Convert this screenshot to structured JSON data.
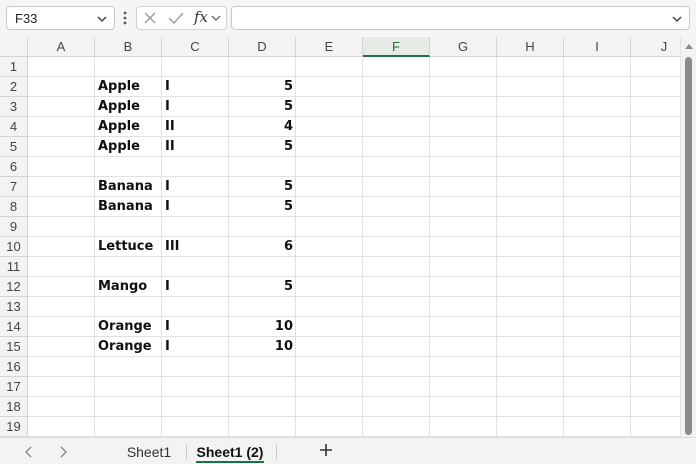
{
  "formula_bar": {
    "name_box": "F33",
    "formula": "",
    "fx_label": "fx",
    "icons": [
      "chevron-down-icon",
      "more-vertical-icon",
      "cancel-x-icon",
      "confirm-check-icon",
      "function-icon"
    ]
  },
  "grid": {
    "columns": [
      "A",
      "B",
      "C",
      "D",
      "E",
      "F",
      "G",
      "H",
      "I",
      "J"
    ],
    "selected_column": "F",
    "rows": [
      "1",
      "2",
      "3",
      "4",
      "5",
      "6",
      "7",
      "8",
      "9",
      "10",
      "11",
      "12",
      "13",
      "14",
      "15",
      "16",
      "17",
      "18",
      "19"
    ],
    "data": [
      {
        "row": "2",
        "B": "Apple",
        "C": "I",
        "D": "5"
      },
      {
        "row": "3",
        "B": "Apple",
        "C": "I",
        "D": "5"
      },
      {
        "row": "4",
        "B": "Apple",
        "C": "II",
        "D": "4"
      },
      {
        "row": "5",
        "B": "Apple",
        "C": "II",
        "D": "5"
      },
      {
        "row": "7",
        "B": "Banana",
        "C": "I",
        "D": "5"
      },
      {
        "row": "8",
        "B": "Banana",
        "C": "I",
        "D": "5"
      },
      {
        "row": "10",
        "B": "Lettuce",
        "C": "III",
        "D": "6"
      },
      {
        "row": "12",
        "B": "Mango",
        "C": "I",
        "D": "5"
      },
      {
        "row": "14",
        "B": "Orange",
        "C": "I",
        "D": "10"
      },
      {
        "row": "15",
        "B": "Orange",
        "C": "I",
        "D": "10"
      }
    ]
  },
  "sheet_tabs": {
    "tabs": [
      "Sheet1",
      "Sheet1 (2)"
    ],
    "active": "Sheet1 (2)",
    "add_icon": "plus-icon",
    "nav_icons": [
      "chevron-left-icon",
      "chevron-right-icon"
    ]
  },
  "colors": {
    "accent": "#1e7145",
    "header_bg": "#f3f3f3",
    "gridline": "#e1e1e1"
  }
}
